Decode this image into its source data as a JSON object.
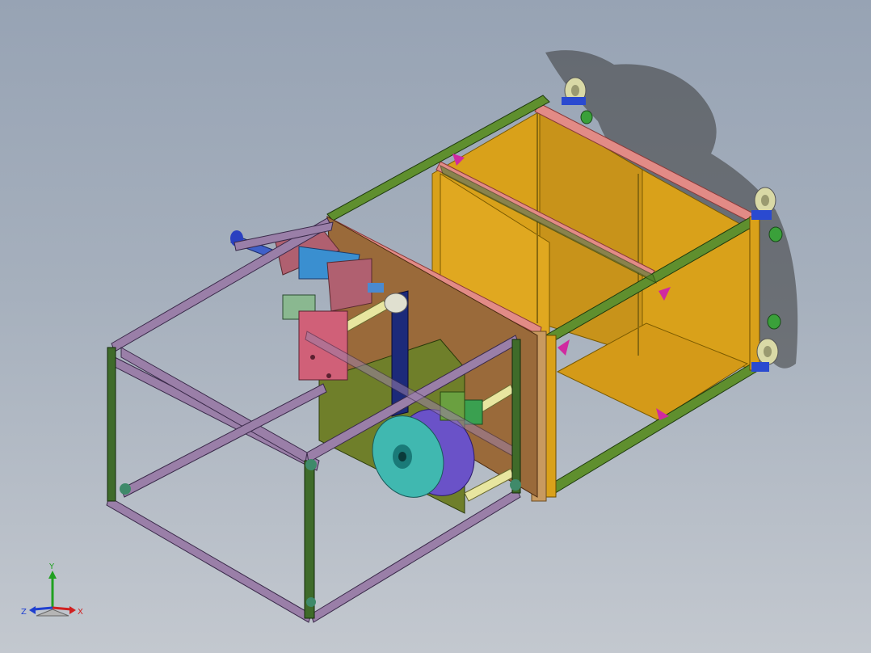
{
  "viewport": {
    "background_top": "#97a3b4",
    "background_bottom": "#c3c8cf"
  },
  "model": {
    "frame_colors": {
      "rear_frame": "#5f8f2e",
      "front_frame": "#9a7fa8",
      "corner_posts": "#3f6b2a",
      "side_rails": "#e28b86",
      "panels": "#d9a11a",
      "plate": "#9a6a3a",
      "base_plate": "#6f7f2a",
      "cylinder": "#b06070",
      "cylinder_ring": "#3a8fd0",
      "rotary_table": "#40b8b0",
      "rotary_housing": "#6a52c8",
      "belt": "#1c2a7a",
      "guide_rods": "#e8e6a0",
      "casters": "#d9d9a6"
    }
  },
  "triad": {
    "x_label": "X",
    "y_label": "Y",
    "z_label": "Z",
    "x_color": "#d02020",
    "y_color": "#20a020",
    "z_color": "#2040d0"
  }
}
